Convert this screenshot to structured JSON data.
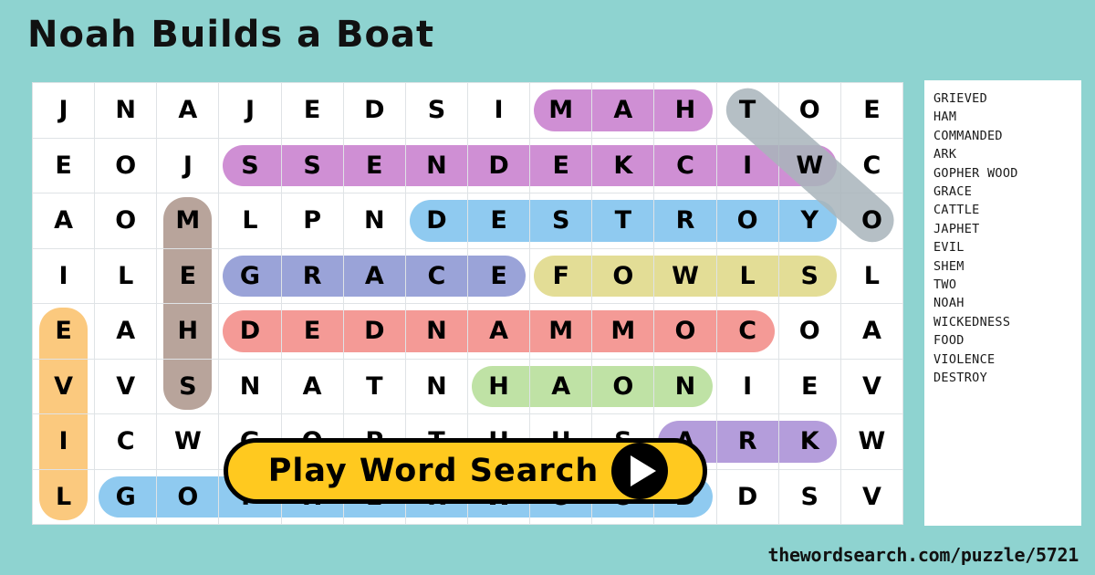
{
  "title": "Noah Builds a Boat",
  "footer": {
    "url": "thewordsearch.com/puzzle/5721"
  },
  "play_button": {
    "label": "Play Word Search",
    "icon": "play-triangle-icon"
  },
  "colors": {
    "background": "#8ed3d0",
    "grid_background": "#ffffff",
    "grid_line": "#dfe3e6",
    "button": "#ffc91f",
    "highlight_purple": "#cf8fd4",
    "highlight_blue": "#8fcaf0",
    "highlight_periwinkle": "#9aa3d8",
    "highlight_red": "#f49a96",
    "highlight_yellow": "#e3dd96",
    "highlight_green": "#bfe2a5",
    "highlight_orange": "#fbc97e",
    "highlight_brown": "#b8a49b",
    "highlight_violet": "#b49ddb",
    "highlight_gray": "#a9b5bb"
  },
  "grid": {
    "rows": 8,
    "cols": 14,
    "letters": [
      [
        "J",
        "N",
        "A",
        "J",
        "E",
        "D",
        "S",
        "I",
        "M",
        "A",
        "H",
        "T",
        "O",
        "E"
      ],
      [
        "E",
        "O",
        "J",
        "S",
        "S",
        "E",
        "N",
        "D",
        "E",
        "K",
        "C",
        "I",
        "W",
        "C"
      ],
      [
        "A",
        "O",
        "M",
        "L",
        "P",
        "N",
        "D",
        "E",
        "S",
        "T",
        "R",
        "O",
        "Y",
        "O"
      ],
      [
        "I",
        "L",
        "E",
        "G",
        "R",
        "A",
        "C",
        "E",
        "F",
        "O",
        "W",
        "L",
        "S",
        "L"
      ],
      [
        "E",
        "A",
        "H",
        "D",
        "E",
        "D",
        "N",
        "A",
        "M",
        "M",
        "O",
        "C",
        "O",
        "A"
      ],
      [
        "V",
        "V",
        "S",
        "N",
        "A",
        "T",
        "N",
        "H",
        "A",
        "O",
        "N",
        "I",
        "E",
        "V"
      ],
      [
        "I",
        "C",
        "W",
        "G",
        "O",
        "P",
        "T",
        "H",
        "U",
        "S",
        "A",
        "R",
        "K",
        "W"
      ],
      [
        "L",
        "G",
        "O",
        "P",
        "H",
        "E",
        "R",
        "W",
        "O",
        "O",
        "D",
        "D",
        "S",
        "V"
      ]
    ],
    "highlights": [
      {
        "word": "HAM",
        "color": "#cf8fd4",
        "orientation": "horizontal",
        "row": 0,
        "col_start": 8,
        "col_end": 10
      },
      {
        "word": "WICKEDNESS",
        "color": "#cf8fd4",
        "orientation": "horizontal",
        "row": 1,
        "col_start": 3,
        "col_end": 12
      },
      {
        "word": "DESTROY",
        "color": "#8fcaf0",
        "orientation": "horizontal",
        "row": 2,
        "col_start": 6,
        "col_end": 12
      },
      {
        "word": "GRACE",
        "color": "#9aa3d8",
        "orientation": "horizontal",
        "row": 3,
        "col_start": 3,
        "col_end": 7
      },
      {
        "word": "FOWLS",
        "color": "#e3dd96",
        "orientation": "horizontal",
        "row": 3,
        "col_start": 8,
        "col_end": 12
      },
      {
        "word": "COMMANDED",
        "color": "#f49a96",
        "orientation": "horizontal",
        "row": 4,
        "col_start": 3,
        "col_end": 11
      },
      {
        "word": "NOAH",
        "color": "#bfe2a5",
        "orientation": "horizontal",
        "row": 5,
        "col_start": 7,
        "col_end": 10
      },
      {
        "word": "ARK",
        "color": "#b49ddb",
        "orientation": "horizontal",
        "row": 6,
        "col_start": 10,
        "col_end": 12
      },
      {
        "word": "GOPHER WOOD",
        "color": "#8fcaf0",
        "orientation": "horizontal",
        "row": 7,
        "col_start": 1,
        "col_end": 10
      },
      {
        "word": "EVIL",
        "color": "#fbc97e",
        "orientation": "vertical",
        "col": 0,
        "row_start": 4,
        "row_end": 7
      },
      {
        "word": "SHEM",
        "color": "#b8a49b",
        "orientation": "vertical",
        "col": 2,
        "row_start": 2,
        "row_end": 5
      },
      {
        "word": "TWO",
        "color": "#a9b5bb",
        "orientation": "diagonal",
        "row_start": 0,
        "col_start": 11,
        "row_end": 2,
        "col_end": 13
      }
    ]
  },
  "word_list": [
    "GRIEVED",
    "HAM",
    "COMMANDED",
    "ARK",
    "GOPHER WOOD",
    "GRACE",
    "CATTLE",
    "JAPHET",
    "EVIL",
    "SHEM",
    "TWO",
    "NOAH",
    "WICKEDNESS",
    "FOOD",
    "VIOLENCE",
    "DESTROY"
  ]
}
